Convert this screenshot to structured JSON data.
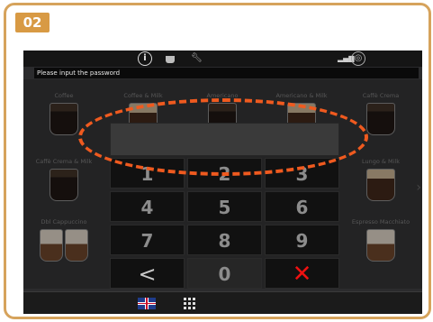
{
  "step": {
    "number": "02"
  },
  "statusbar": {
    "icons": [
      "info-icon",
      "cup-icon",
      "wrench-icon",
      "signal-icon",
      "globe-icon"
    ],
    "info_glyph": "i"
  },
  "prompt": {
    "text": "Please input the password"
  },
  "drinks": [
    {
      "label": "Coffee"
    },
    {
      "label": "Coffee & Milk"
    },
    {
      "label": "Americano"
    },
    {
      "label": "Americano & Milk"
    },
    {
      "label": "Caffè Crema"
    },
    {
      "label": "Caffè Crema & Milk"
    },
    {
      "label": "Lungo & Milk"
    },
    {
      "label": "Dbl Cappuccino"
    },
    {
      "label": "Espresso Macchiato"
    }
  ],
  "keypad": {
    "keys": [
      "1",
      "2",
      "3",
      "4",
      "5",
      "6",
      "7",
      "8",
      "9",
      "<",
      "0",
      "✕"
    ]
  },
  "bottombar": {
    "language_icon": "uk-flag-icon",
    "menu_icon": "grid-icon"
  },
  "colors": {
    "frame": "#d6a35c",
    "badge": "#d89a44",
    "highlight": "#ef5a1f",
    "cancel": "#ee1111"
  }
}
